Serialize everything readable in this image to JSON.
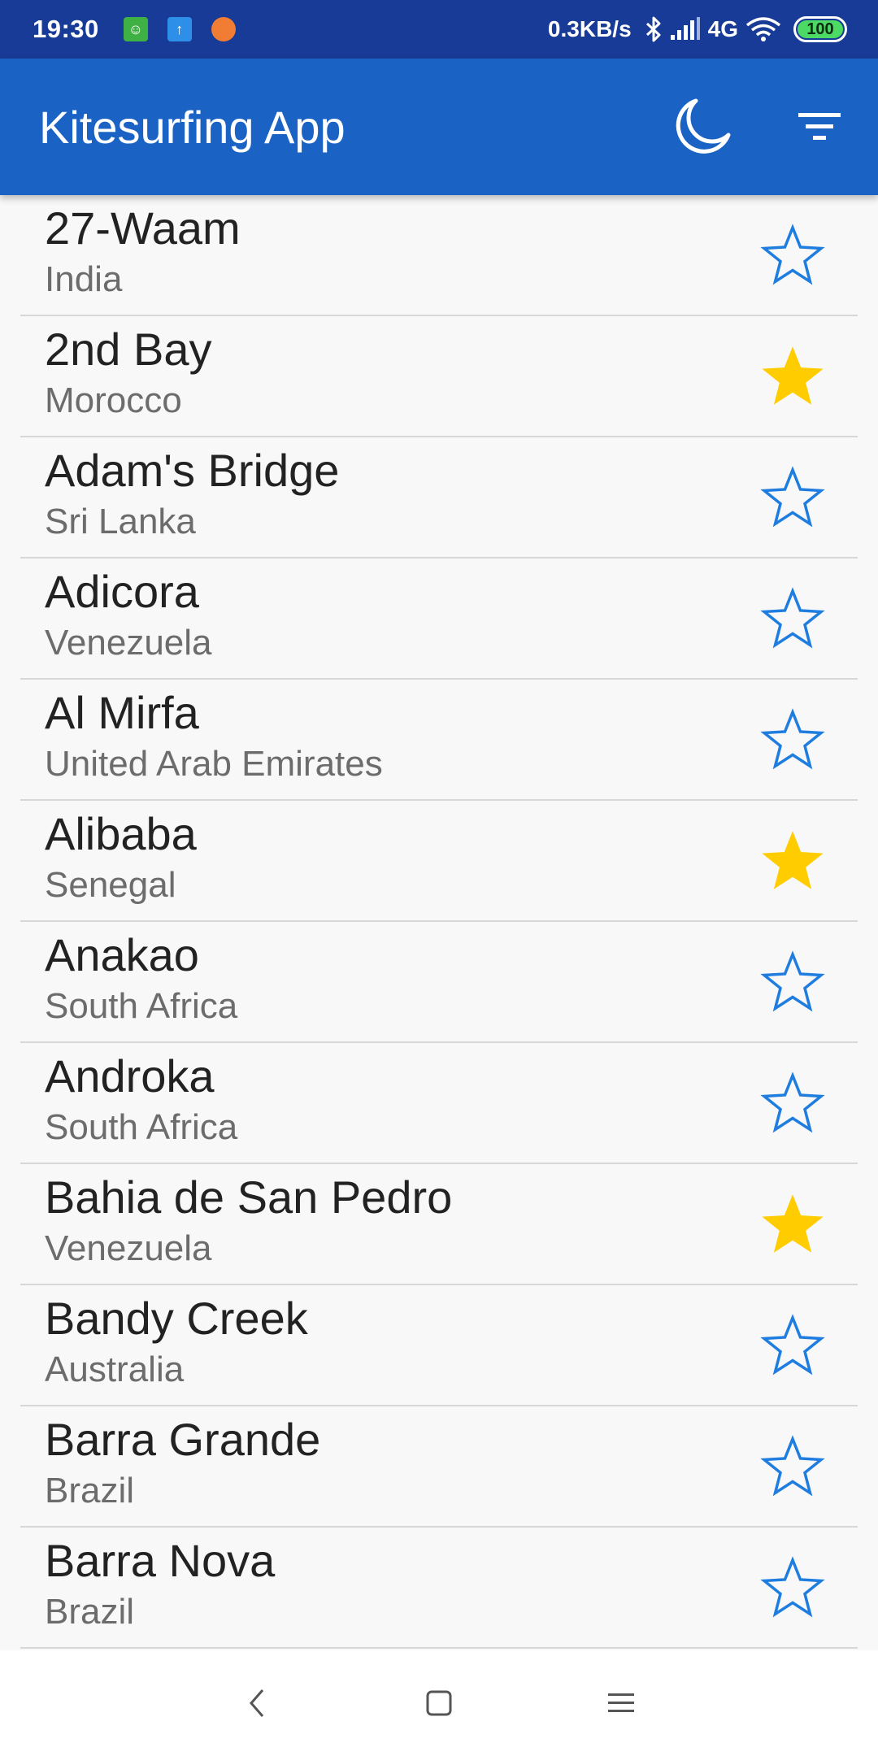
{
  "status_bar": {
    "time": "19:30",
    "net_speed": "0.3KB/s",
    "net_type": "4G",
    "battery": "100",
    "notification_icons": [
      "android-app-icon",
      "upload-app-icon",
      "orange-app-icon"
    ]
  },
  "app_bar": {
    "title": "Kitesurfing App",
    "actions": [
      "moon-icon",
      "filter-icon"
    ]
  },
  "colors": {
    "status_bar": "#173b96",
    "app_bar": "#1a63c4",
    "star_outline": "#1f7de0",
    "star_filled": "#ffcc00",
    "list_bg": "#f8f8f8"
  },
  "spots": [
    {
      "name": "27-Waam",
      "country": "India",
      "favorite": false
    },
    {
      "name": "2nd Bay",
      "country": "Morocco",
      "favorite": true
    },
    {
      "name": "Adam's Bridge",
      "country": "Sri Lanka",
      "favorite": false
    },
    {
      "name": "Adicora",
      "country": "Venezuela",
      "favorite": false
    },
    {
      "name": "Al Mirfa",
      "country": "United Arab Emirates",
      "favorite": false
    },
    {
      "name": "Alibaba",
      "country": "Senegal",
      "favorite": true
    },
    {
      "name": "Anakao",
      "country": "South Africa",
      "favorite": false
    },
    {
      "name": "Androka",
      "country": "South Africa",
      "favorite": false
    },
    {
      "name": "Bahia de San Pedro",
      "country": "Venezuela",
      "favorite": true
    },
    {
      "name": "Bandy Creek",
      "country": "Australia",
      "favorite": false
    },
    {
      "name": "Barra Grande",
      "country": "Brazil",
      "favorite": false
    },
    {
      "name": "Barra Nova",
      "country": "Brazil",
      "favorite": false
    }
  ],
  "nav_bar": {
    "buttons": [
      "back-icon",
      "home-icon",
      "recents-icon"
    ]
  }
}
